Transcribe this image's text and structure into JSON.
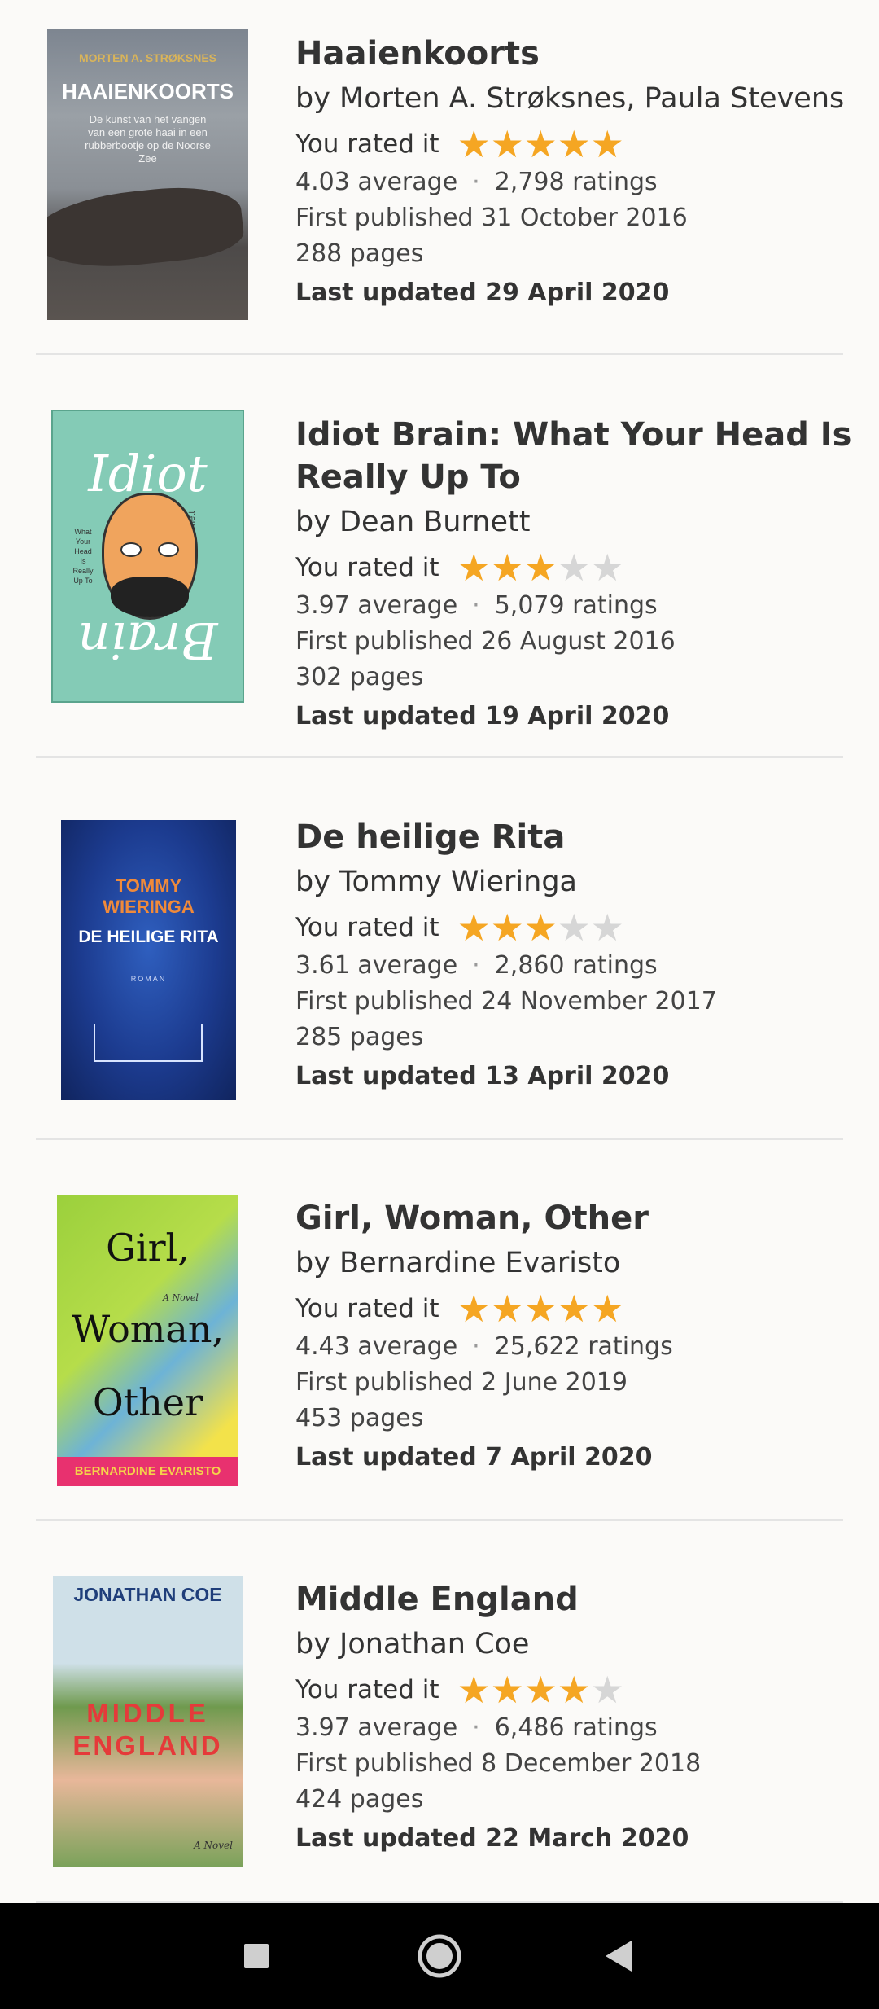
{
  "rated_label": "You rated it",
  "books": [
    {
      "title": "Haaienkoorts",
      "author": "by Morten A. Strøksnes, Paula Stevens",
      "rating": 5,
      "average": "4.03 average",
      "ratings": "2,798 ratings",
      "published": "First published 31 October 2016",
      "pages": "288 pages",
      "updated": "Last updated 29 April 2020",
      "cover": {
        "author": "MORTEN A. STRØKSNES",
        "title": "HAAIENKOORTS",
        "subtitle": "De kunst van het vangen van een grote haai in een rubberbootje op de Noorse Zee"
      }
    },
    {
      "title": "Idiot Brain: What Your Head Is Really Up To",
      "author": "by Dean Burnett",
      "rating": 3,
      "average": "3.97 average",
      "ratings": "5,079 ratings",
      "published": "First published 26 August 2016",
      "pages": "302 pages",
      "updated": "Last updated 19 April 2020",
      "cover": {
        "top": "Idiot",
        "bottom": "Brain",
        "side": "What Your Head Is Really Up To",
        "author": "Dean Burnett"
      }
    },
    {
      "title": "De heilige Rita",
      "author": "by Tommy Wieringa",
      "rating": 3,
      "average": "3.61 average",
      "ratings": "2,860 ratings",
      "published": "First published 24 November 2017",
      "pages": "285 pages",
      "updated": "Last updated 13 April 2020",
      "cover": {
        "author": "TOMMY WIERINGA",
        "title": "DE HEILIGE RITA",
        "subtitle": "ROMAN"
      }
    },
    {
      "title": "Girl, Woman, Other",
      "author": "by Bernardine Evaristo",
      "rating": 5,
      "average": "4.43 average",
      "ratings": "25,622 ratings",
      "published": "First published 2 June 2019",
      "pages": "453 pages",
      "updated": "Last updated 7 April 2020",
      "cover": {
        "w1": "Girl,",
        "w2": "Woman,",
        "w3": "Other",
        "novel": "A Novel",
        "author": "BERNARDINE EVARISTO"
      }
    },
    {
      "title": "Middle England",
      "author": "by Jonathan Coe",
      "rating": 4,
      "average": "3.97 average",
      "ratings": "6,486 ratings",
      "published": "First published 8 December 2018",
      "pages": "424 pages",
      "updated": "Last updated 22 March 2020",
      "cover": {
        "author": "JONATHAN COE",
        "t1": "MIDDLE",
        "t2": "ENGLAND",
        "novel": "A Novel"
      }
    }
  ],
  "nav": {
    "recents": "recents-button",
    "home": "home-button",
    "back": "back-button"
  }
}
